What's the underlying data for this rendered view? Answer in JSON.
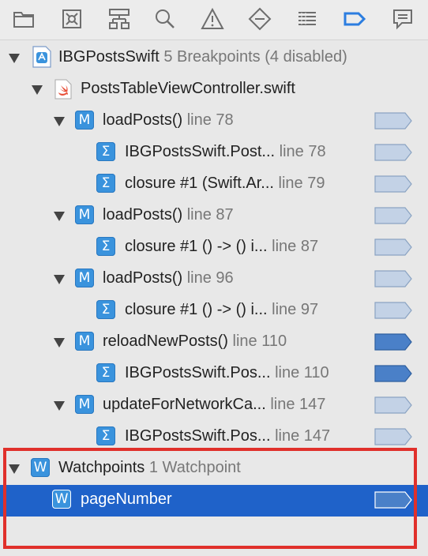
{
  "toolbar": {
    "icons": [
      "folder-icon",
      "x-square-icon",
      "hierarchy-icon",
      "search-icon",
      "warning-icon",
      "diamond-minus-icon",
      "list-icon",
      "breakpoint-navigator-icon",
      "chat-bubble-icon"
    ],
    "active_icon": "breakpoint-navigator-icon",
    "accent_color": "#2b7de0"
  },
  "project": {
    "name": "IBGPostsSwift",
    "summary": "5 Breakpoints (4 disabled)"
  },
  "file": {
    "name": "PostsTableViewController.swift"
  },
  "breakpoints": [
    {
      "kind": "M",
      "name": "loadPosts()",
      "line": "line 78",
      "enabled": false
    },
    {
      "kind": "Σ",
      "name": "IBGPostsSwift.Post...",
      "line": "line 78",
      "enabled": false
    },
    {
      "kind": "Σ",
      "name": "closure #1 (Swift.Ar...",
      "line": "line 79",
      "enabled": false
    },
    {
      "kind": "M",
      "name": "loadPosts()",
      "line": "line 87",
      "enabled": false
    },
    {
      "kind": "Σ",
      "name": "closure #1 () -> () i...",
      "line": "line 87",
      "enabled": false
    },
    {
      "kind": "M",
      "name": "loadPosts()",
      "line": "line 96",
      "enabled": false
    },
    {
      "kind": "Σ",
      "name": "closure #1 () -> () i...",
      "line": "line 97",
      "enabled": false
    },
    {
      "kind": "M",
      "name": "reloadNewPosts()",
      "line": "line 110",
      "enabled": true
    },
    {
      "kind": "Σ",
      "name": "IBGPostsSwift.Pos...",
      "line": "line 110",
      "enabled": true
    },
    {
      "kind": "M",
      "name": "updateForNetworkCa...",
      "line": "line 147",
      "enabled": false
    },
    {
      "kind": "Σ",
      "name": "IBGPostsSwift.Pos...",
      "line": "line 147",
      "enabled": false
    }
  ],
  "watchpoints": {
    "kind": "W",
    "title": "Watchpoints",
    "summary": "1 Watchpoint",
    "items": [
      {
        "kind": "W",
        "name": "pageNumber",
        "enabled": true
      }
    ]
  },
  "colors": {
    "enabled_fill": "#4a80c8",
    "disabled_fill": "#c3d2e6",
    "selection": "#1f62c9",
    "annotation_border": "#e0302b"
  }
}
